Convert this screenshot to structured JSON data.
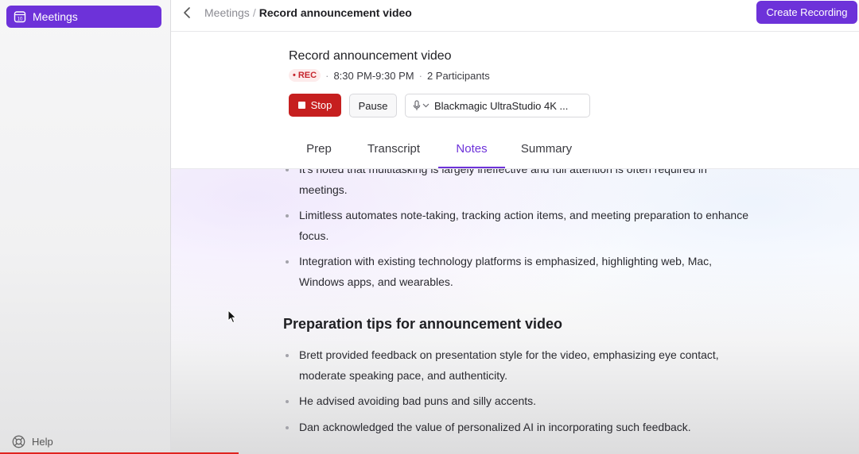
{
  "sidebar": {
    "active_item": {
      "label": "Meetings",
      "icon": "calendar-icon"
    },
    "help": {
      "label": "Help",
      "icon": "lifebuoy-icon"
    }
  },
  "topbar": {
    "breadcrumb_parent": "Meetings",
    "breadcrumb_separator": "/",
    "breadcrumb_current": "Record announcement video",
    "create_button": "Create Recording"
  },
  "recording": {
    "title": "Record announcement video",
    "badge": "REC",
    "time": "8:30 PM-9:30 PM",
    "separator": "·",
    "participants": "2 Participants",
    "stop_label": "Stop",
    "pause_label": "Pause",
    "device": "Blackmagic UltraStudio 4K ..."
  },
  "tabs": [
    {
      "label": "Prep",
      "active": false
    },
    {
      "label": "Transcript",
      "active": false
    },
    {
      "label": "Notes",
      "active": true
    },
    {
      "label": "Summary",
      "active": false
    }
  ],
  "notes": {
    "top_bullets": [
      "It's noted that multitasking is largely ineffective and full attention is often required in meetings.",
      "Limitless automates note-taking, tracking action items, and meeting preparation to enhance focus.",
      "Integration with existing technology platforms is emphasized, highlighting web, Mac, Windows apps, and wearables."
    ],
    "section_heading": "Preparation tips for announcement video",
    "section_bullets": [
      "Brett provided feedback on presentation style for the video, emphasizing eye contact, moderate speaking pace, and authenticity.",
      "He advised avoiding bad puns and silly accents.",
      "Dan acknowledged the value of personalized AI in incorporating such feedback."
    ]
  },
  "colors": {
    "accent": "#6d32d9",
    "stop": "#c61f1f",
    "rec_text": "#c6262e",
    "rec_bg": "#fdecec"
  }
}
